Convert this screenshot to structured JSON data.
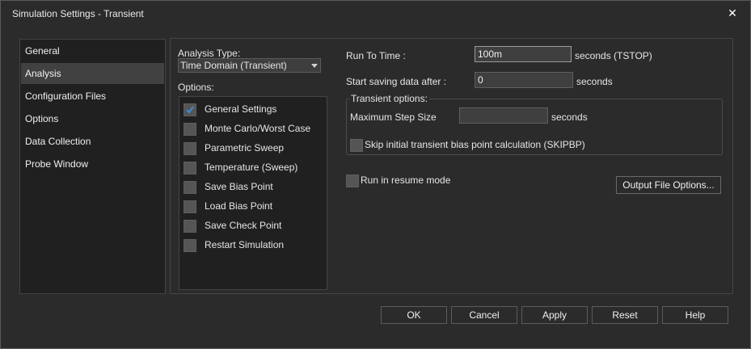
{
  "window": {
    "title": "Simulation Settings - Transient",
    "close_glyph": "✕"
  },
  "nav": {
    "items": [
      "General",
      "Analysis",
      "Configuration Files",
      "Options",
      "Data Collection",
      "Probe Window"
    ],
    "selected": "Analysis"
  },
  "analysis": {
    "type_label": "Analysis Type:",
    "type_value": "Time Domain (Transient)",
    "options_label": "Options:",
    "options": [
      {
        "label": "General Settings",
        "checked": true
      },
      {
        "label": "Monte Carlo/Worst Case",
        "checked": false
      },
      {
        "label": "Parametric Sweep",
        "checked": false
      },
      {
        "label": "Temperature (Sweep)",
        "checked": false
      },
      {
        "label": "Save Bias Point",
        "checked": false
      },
      {
        "label": "Load Bias Point",
        "checked": false
      },
      {
        "label": "Save Check Point",
        "checked": false
      },
      {
        "label": "Restart Simulation",
        "checked": false
      }
    ]
  },
  "transient": {
    "run_to_time_label": "Run To Time :",
    "run_to_time_value": "100m",
    "run_to_time_unit": "seconds (TSTOP)",
    "start_saving_label": "Start saving data after :",
    "start_saving_value": "0",
    "start_saving_unit": "seconds",
    "group_title": "Transient options:",
    "max_step_label": "Maximum Step Size",
    "max_step_value": "",
    "max_step_unit": "seconds",
    "skip_bias_label": "Skip initial transient bias point calculation (SKIPBP)",
    "skip_bias_checked": false,
    "resume_label": "Run in resume mode",
    "resume_checked": false,
    "output_file_button": "Output File Options..."
  },
  "buttons": {
    "ok": "OK",
    "cancel": "Cancel",
    "apply": "Apply",
    "reset": "Reset",
    "help": "Help"
  },
  "colors": {
    "background": "#2b2b2b",
    "list_bg": "#202020",
    "selected": "#414141",
    "check_accent": "#3b8ed8"
  }
}
